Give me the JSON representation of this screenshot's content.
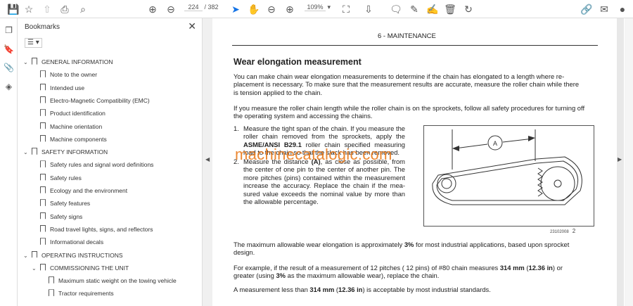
{
  "toolbar": {
    "page_current": "224",
    "page_total": "/ 382",
    "zoom": "109%"
  },
  "bookmarks": {
    "title": "Bookmarks",
    "items": [
      {
        "label": "GENERAL INFORMATION",
        "level": 0,
        "expanded": true
      },
      {
        "label": "Note to the owner",
        "level": 1
      },
      {
        "label": "Intended use",
        "level": 1
      },
      {
        "label": "Electro-Magnetic Compatibility (EMC)",
        "level": 1
      },
      {
        "label": "Product identification",
        "level": 1
      },
      {
        "label": "Machine orientation",
        "level": 1
      },
      {
        "label": "Machine components",
        "level": 1
      },
      {
        "label": "SAFETY INFORMATION",
        "level": 0,
        "expanded": true
      },
      {
        "label": "Safety rules and signal word definitions",
        "level": 1
      },
      {
        "label": "Safety rules",
        "level": 1
      },
      {
        "label": "Ecology and the environment",
        "level": 1
      },
      {
        "label": "Safety features",
        "level": 1
      },
      {
        "label": "Safety signs",
        "level": 1
      },
      {
        "label": "Road travel lights, signs, and reflectors",
        "level": 1
      },
      {
        "label": "Informational decals",
        "level": 1
      },
      {
        "label": "OPERATING INSTRUCTIONS",
        "level": 0,
        "expanded": true
      },
      {
        "label": "COMMISSIONING THE UNIT",
        "level": 1,
        "expanded": true
      },
      {
        "label": "Maximum static weight on the towing vehicle",
        "level": 2
      },
      {
        "label": "Tractor requirements",
        "level": 2
      }
    ]
  },
  "document": {
    "header": "6 - MAINTENANCE",
    "title": "Wear elongation measurement",
    "para1": "You can make chain wear elongation measurements to determine if the chain has elongated to a length where re-placement is necessary.  To make sure that the measurement results are accurate, measure the roller chain while there is tension applied to the chain.",
    "para2": "If you measure the roller chain length while the roller chain is on the sprockets, follow all safety procedures for turning off the operating system and accessing the chains.",
    "step1_a": "Measure the tight span of the chain.  If you measure the roller chain removed from the sprockets, apply the ",
    "step1_b": "ASME/ANSI B29.1",
    "step1_c": " roller chain specified measuring load to the chain so that the slack has been removed.",
    "step2_a": "Measure the distance ",
    "step2_b": "(A)",
    "step2_c": ", as close as possible, from the center of one pin to the center of another pin. The more pitches (pins) contained within the measurement increase the accuracy. Replace the chain if the mea-sured value exceeds the nominal value by more than the allowable percentage.",
    "fig_label": "A",
    "fig_code": "23102008",
    "fig_num": "2",
    "para3_a": "The maximum allowable wear elongation is approximately ",
    "para3_b": "3%",
    "para3_c": " for most industrial applications, based upon sprocket design.",
    "para4_a": "For example, if the result of a measurement of 12 pitches ( 12 pins) of #80 chain measures ",
    "para4_b": "314 mm",
    "para4_c": " (",
    "para4_d": "12.36 in",
    "para4_e": ") or greater (using ",
    "para4_f": "3%",
    "para4_g": " as the maximum allowable wear), replace the chain.",
    "para5_a": "A measurement less than ",
    "para5_b": "314 mm",
    "para5_c": " (",
    "para5_d": "12.36 in",
    "para5_e": ") is acceptable by most industrial standards.",
    "watermark": "machinecatalogic.com"
  }
}
